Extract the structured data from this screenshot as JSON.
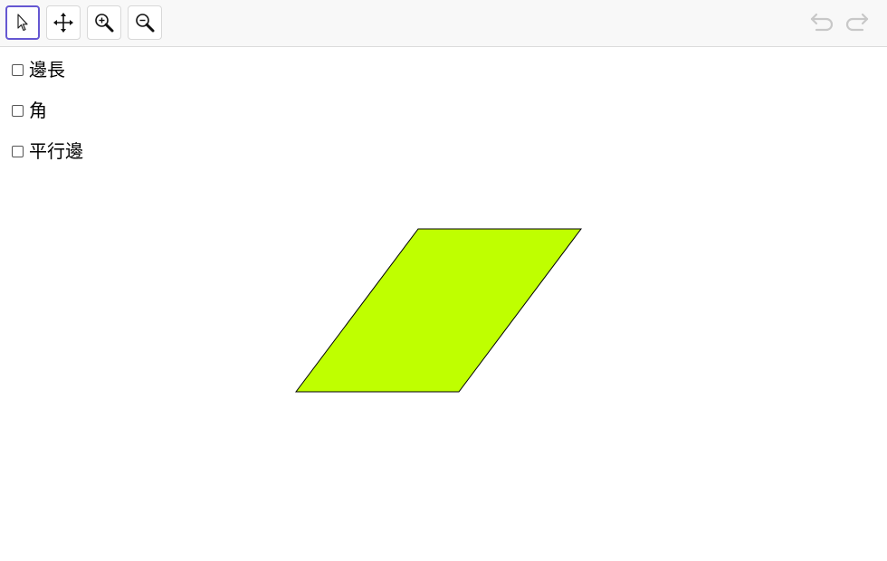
{
  "toolbar": {
    "tools": [
      {
        "name": "move-tool",
        "icon": "arrow-pointer-icon",
        "active": true
      },
      {
        "name": "move-graphics-view-tool",
        "icon": "four-way-arrows-icon",
        "active": false
      },
      {
        "name": "zoom-in-tool",
        "icon": "zoom-in-icon",
        "active": false
      },
      {
        "name": "zoom-out-tool",
        "icon": "zoom-out-icon",
        "active": false
      }
    ],
    "undo_icon": "undo-icon",
    "redo_icon": "redo-icon"
  },
  "checkboxes": [
    {
      "label": "邊長",
      "checked": false
    },
    {
      "label": "角",
      "checked": false
    },
    {
      "label": "平行邊",
      "checked": false
    }
  ],
  "shape": {
    "type": "parallelogram",
    "fill_color": "#BFFF00",
    "stroke_color": "#000000"
  },
  "colors": {
    "active_tool_border": "#6557d2",
    "toolbar_bg": "#f8f8f8",
    "disabled_icon": "#c8c8c8"
  }
}
